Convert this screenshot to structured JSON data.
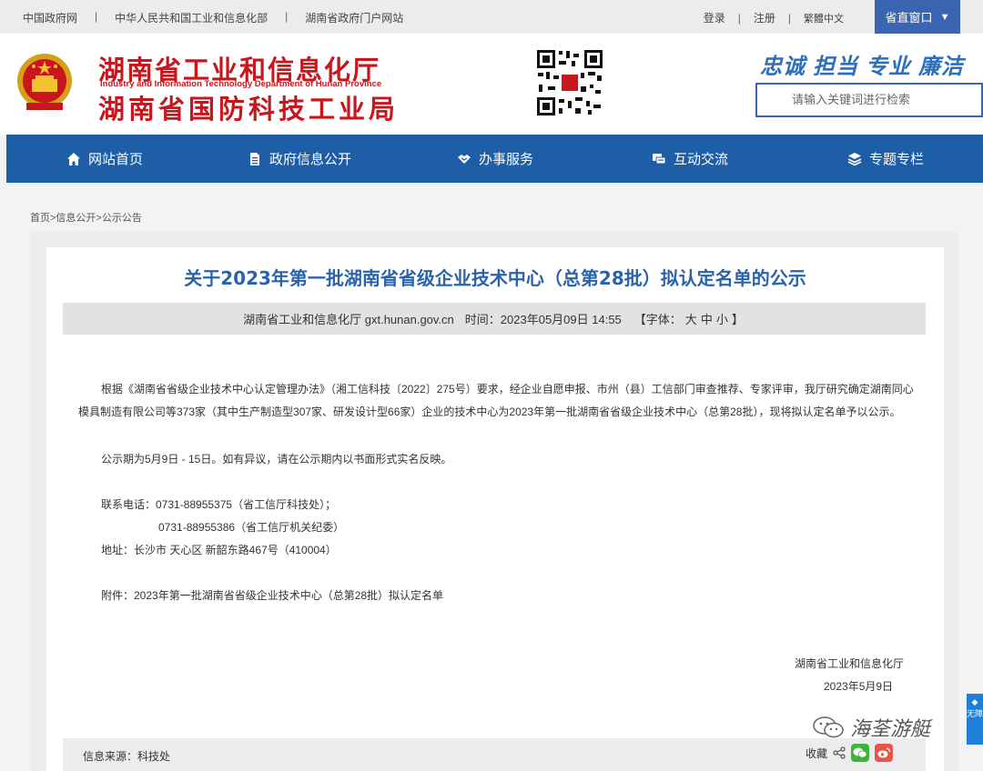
{
  "topbar": {
    "links": [
      "中国政府网",
      "中华人民共和国工业和信息化部",
      "湖南省政府门户网站"
    ],
    "login": "登录",
    "register": "注册",
    "traditional": "繁體中文",
    "window_button": "省直窗口"
  },
  "header": {
    "logo_cn_line1": "湖南省工业和信息化厅",
    "logo_en": "Industry and Information Technology Department of Hunan Province",
    "logo_cn_line2": "湖南省国防科技工业局",
    "slogans": [
      "忠诚",
      "担当",
      "专业",
      "廉洁"
    ],
    "search_placeholder": "请输入关键词进行检索"
  },
  "nav": {
    "items": [
      {
        "label": "网站首页",
        "icon": "home-icon"
      },
      {
        "label": "政府信息公开",
        "icon": "document-icon"
      },
      {
        "label": "办事服务",
        "icon": "handshake-icon"
      },
      {
        "label": "互动交流",
        "icon": "chat-icon"
      },
      {
        "label": "专题专栏",
        "icon": "layers-icon"
      }
    ]
  },
  "breadcrumb": "首页>信息公开>公示公告",
  "article": {
    "title": "关于2023年第一批湖南省省级企业技术中心（总第28批）拟认定名单的公示",
    "meta_source": "湖南省工业和信息化厅 gxt.hunan.gov.cn",
    "meta_time": "时间：2023年05月09日 14:55",
    "meta_font_label": "【字体：",
    "meta_font_sizes": [
      "大",
      "中",
      "小"
    ],
    "meta_font_end": "】",
    "para1": "根据《湖南省省级企业技术中心认定管理办法》（湘工信科技〔2022〕275号）要求，经企业自愿申报、市州（县）工信部门审查推荐、专家评审，我厅研究确定湖南同心模具制造有限公司等373家（其中生产制造型307家、研发设计型66家）企业的技术中心为2023年第一批湖南省省级企业技术中心（总第28批），现将拟认定名单予以公示。",
    "para2": "公示期为5月9日 - 15日。如有异议，请在公示期内以书面形式实名反映。",
    "contact_phone1": "联系电话：0731-88955375（省工信厅科技处）；",
    "contact_phone2": "0731-88955386（省工信厅机关纪委）",
    "address": "地址：长沙市 天心区 新韶东路467号（410004）",
    "attachment": "附件：2023年第一批湖南省省级企业技术中心（总第28批）拟认定名单",
    "sign_org": "湖南省工业和信息化厅",
    "sign_date": "2023年5月9日"
  },
  "watermark": "海荃游艇",
  "sidetab": "无障",
  "footer": {
    "source": "信息来源：科技处",
    "collect": "收藏"
  },
  "colors": {
    "brand_blue": "#1d5ea6",
    "title_blue": "#2a63aa",
    "logo_red": "#c8161d"
  }
}
